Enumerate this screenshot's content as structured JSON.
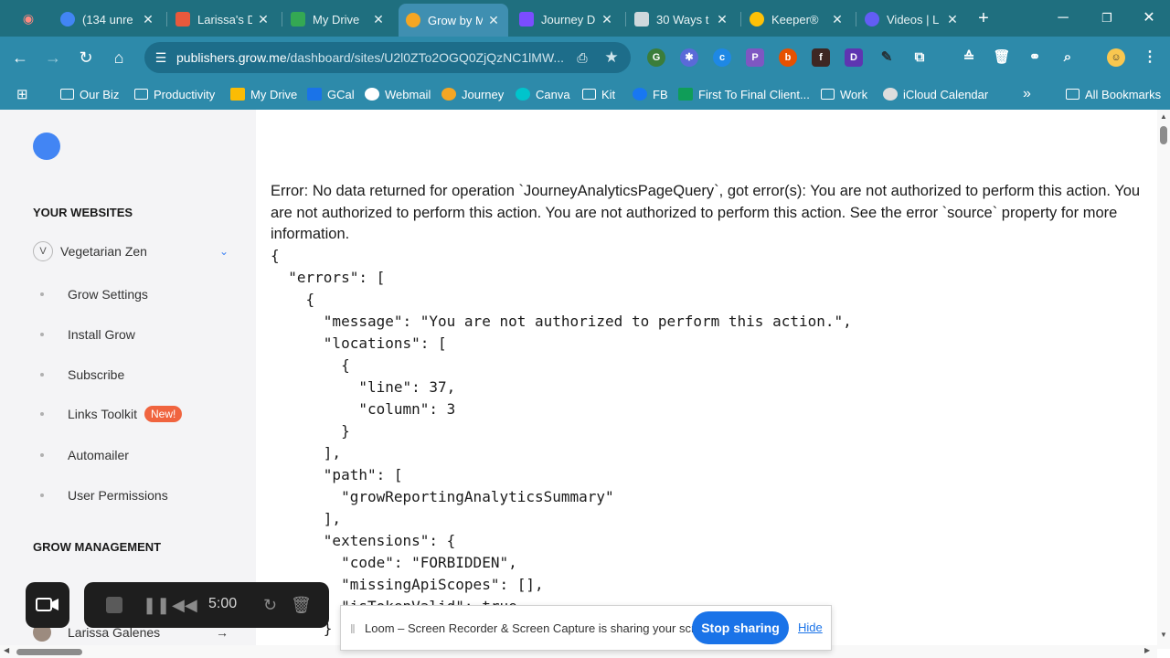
{
  "browser": {
    "tabs": [
      {
        "title": "(134 unre",
        "favicon_color": "#4285f4"
      },
      {
        "title": "Larissa's D",
        "favicon_color": "#e8593c"
      },
      {
        "title": "My Drive",
        "favicon_color": "#34a853"
      },
      {
        "title": "Grow by M",
        "favicon_color": "#f5a623"
      },
      {
        "title": "Journey D",
        "favicon_color": "#7b4dff"
      },
      {
        "title": "30 Ways t",
        "favicon_color": "#cfd8dc"
      },
      {
        "title": "Keeper®",
        "favicon_color": "#ffc107"
      },
      {
        "title": "Videos | L",
        "favicon_color": "#625df5"
      }
    ],
    "active_tab_index": 3,
    "url_host": "publishers.grow.me",
    "url_path": "/dashboard/sites/U2l0ZTo2OGQ0ZjQzNC1lMW...",
    "bookmarks": [
      {
        "label": "Our Biz",
        "icon": "folder-icon"
      },
      {
        "label": "Productivity",
        "icon": "folder-icon"
      },
      {
        "label": "My Drive",
        "icon": "drive-icon"
      },
      {
        "label": "GCal",
        "icon": "calendar-icon"
      },
      {
        "label": "Webmail",
        "icon": "globe-icon"
      },
      {
        "label": "Journey",
        "icon": "journey-icon"
      },
      {
        "label": "Canva",
        "icon": "canva-icon"
      },
      {
        "label": "Kit",
        "icon": "folder-icon"
      },
      {
        "label": "FB",
        "icon": "facebook-icon"
      },
      {
        "label": "First To Final Client...",
        "icon": "plus-icon"
      },
      {
        "label": "Work",
        "icon": "folder-icon"
      },
      {
        "label": "iCloud Calendar",
        "icon": "apple-icon"
      }
    ],
    "all_bookmarks_label": "All Bookmarks",
    "more_bookmarks": "»"
  },
  "sidebar": {
    "your_websites_title": "YOUR WEBSITES",
    "site": {
      "avatar_letter": "V",
      "name": "Vegetarian Zen"
    },
    "items": [
      {
        "label": "Grow Settings"
      },
      {
        "label": "Install Grow"
      },
      {
        "label": "Subscribe"
      },
      {
        "label": "Links Toolkit",
        "badge": "New!"
      },
      {
        "label": "Automailer"
      },
      {
        "label": "User Permissions"
      }
    ],
    "grow_management_title": "GROW MANAGEMENT",
    "user_name": "Larissa Galenes",
    "logout_arrow": "→"
  },
  "error": {
    "heading": "Error: No data returned for operation `JourneyAnalyticsPageQuery`, got error(s): You are not authorized to perform this action. You are not authorized to perform this action. You are not authorized to perform this action. See the error `source` property for more information.",
    "json_lines": [
      "{",
      "  \"errors\": [",
      "    {",
      "      \"message\": \"You are not authorized to perform this action.\",",
      "      \"locations\": [",
      "        {",
      "          \"line\": 37,",
      "          \"column\": 3",
      "        }",
      "      ],",
      "      \"path\": [",
      "        \"growReportingAnalyticsSummary\"",
      "      ],",
      "      \"extensions\": {",
      "        \"code\": \"FORBIDDEN\",",
      "        \"missingApiScopes\": [],",
      "        \"isTokenValid\": true",
      "      }"
    ]
  },
  "loom": {
    "timer": "5:00",
    "share_message": "Loom – Screen Recorder & Screen Capture is sharing your screen.",
    "stop_label": "Stop sharing",
    "hide_label": "Hide"
  }
}
